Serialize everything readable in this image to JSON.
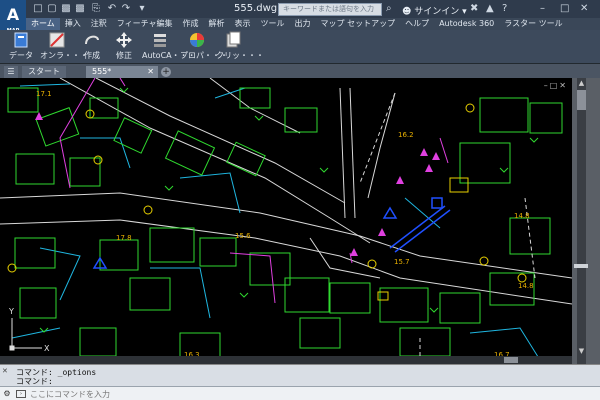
{
  "titlebar": {
    "logo": "A",
    "logo_sub": "MAP",
    "document_title": "555.dwg",
    "search_placeholder": "キーワードまたは語句を入力",
    "signin_label": "サインイン"
  },
  "menu": [
    "ホーム",
    "挿入",
    "注釈",
    "フィーチャ編集",
    "作成",
    "解析",
    "表示",
    "ツール",
    "出力",
    "マップ セットアップ",
    "ヘルプ",
    "Autodesk 360",
    "ラスター ツール"
  ],
  "ribbon": [
    {
      "label": "データ",
      "icon": "data-icon"
    },
    {
      "label": "オンラ・・・",
      "icon": "online-icon"
    },
    {
      "label": "作成",
      "icon": "create-icon"
    },
    {
      "label": "修正",
      "icon": "modify-icon"
    },
    {
      "label": "AutoCA・・・",
      "icon": "autocad-icon"
    },
    {
      "label": "プロパ・・・",
      "icon": "properties-icon"
    },
    {
      "label": "クリッ・・・",
      "icon": "clipboard-icon"
    }
  ],
  "file_tabs": [
    "スタート",
    "555*"
  ],
  "drawing_labels": [
    "17.1",
    "16.2",
    "14.8",
    "17.8",
    "15.6",
    "15.7",
    "14.8",
    "16.3",
    "16.7"
  ],
  "ucs": {
    "y": "Y",
    "x": "X"
  },
  "command": {
    "history": [
      "コマンド: _options",
      "コマンド:"
    ],
    "placeholder": "ここにコマンドを入力"
  },
  "colors": {
    "titlebar": "#2f3b4c",
    "ribbon": "#3d4a5c",
    "canvas": "#000000",
    "parcel_green": "#2fd92f",
    "road_white": "#d8d8d8",
    "line_cyan": "#1fb6e0",
    "magenta": "#e040e0",
    "blue": "#2050ff",
    "yellow": "#e8d000"
  }
}
